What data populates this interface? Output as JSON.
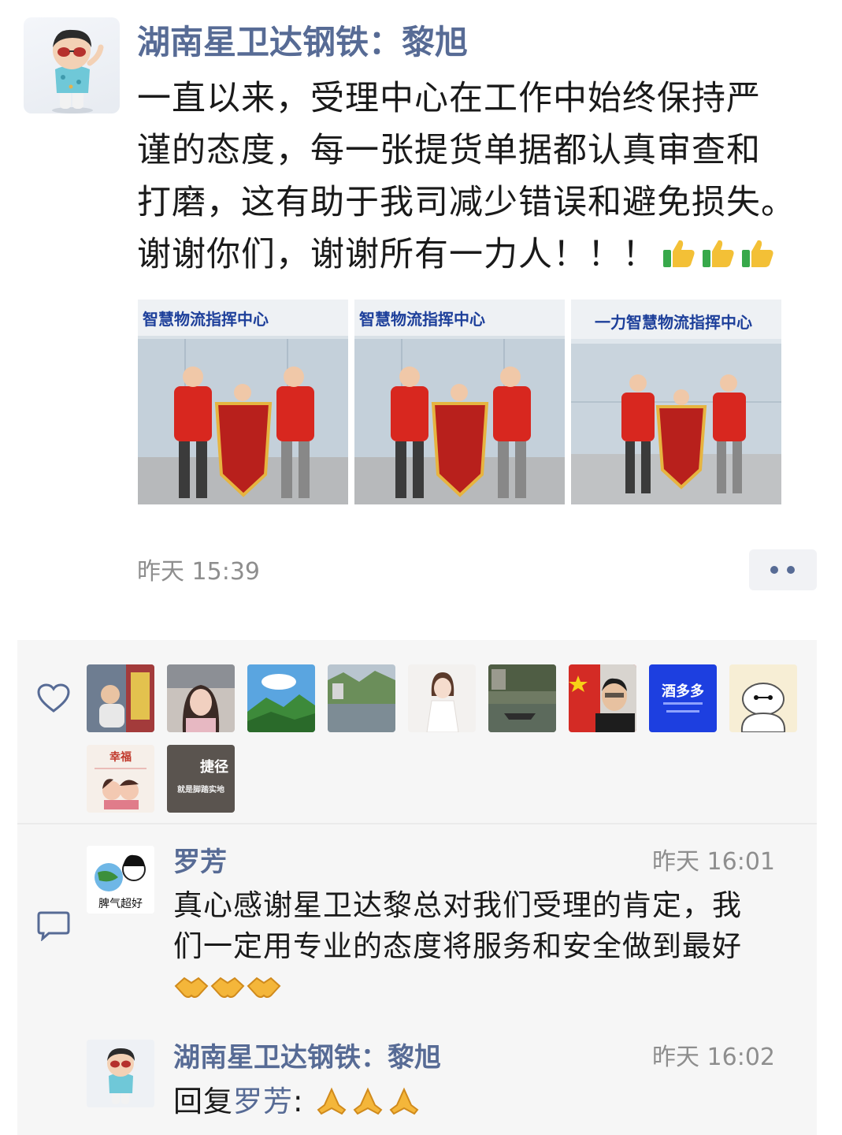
{
  "post": {
    "author": "湖南星卫达钢铁：黎旭",
    "text_lines": [
      "一直以来，受理中心在工作中始终保持严",
      "谨的态度，每一张提货单据都认真审查和",
      "打磨，这有助于我司减少错误和避免损失。",
      "谢谢你们，谢谢所有一力人！！！"
    ],
    "emoji": "thumbs-up",
    "photos": [
      {
        "banner": "智慧物流指挥中心"
      },
      {
        "banner": "智慧物流指挥中心"
      },
      {
        "banner": "一力智慧物流指挥中心"
      }
    ],
    "time": "昨天 15:39"
  },
  "likes": {
    "icon": "heart-icon",
    "avatar_texts": {
      "jiuduoduo": "酒多多",
      "xingfu": "幸福",
      "jiejing": "捷径",
      "jiejing_sub": "就是脚踏实地"
    }
  },
  "comments": [
    {
      "author": "罗芳",
      "time": "昨天 16:01",
      "avatar_caption": "脾气超好",
      "text_lines": [
        "真心感谢星卫达黎总对我们受理的肯定，我",
        "们一定用专业的态度将服务和安全做到最好"
      ],
      "emoji": "handshake"
    },
    {
      "author": "湖南星卫达钢铁：黎旭",
      "time": "昨天 16:02",
      "reply_prefix": "回复",
      "reply_to": "罗芳",
      "reply_colon": ":",
      "emoji": "folded-hands"
    }
  ],
  "colors": {
    "link": "#576b95",
    "text": "#1a1a1a",
    "muted": "#8e8e8e",
    "panel": "#f6f6f6"
  }
}
